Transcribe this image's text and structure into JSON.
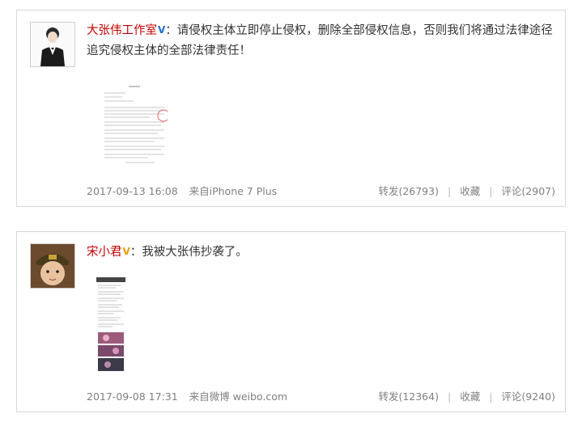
{
  "posts": [
    {
      "author": "大张伟工作室",
      "badge": "V",
      "badge_color": "#1e6cc8",
      "text": "请侵权主体立即停止侵权，删除全部侵权信息，否则我们将通过法律途径追究侵权主体的全部法律责任！",
      "colon": "：",
      "time": "2017-09-13 16:08",
      "source": "来自iPhone 7 Plus",
      "repost": "转发(26793)",
      "favorite": "收藏",
      "comment": "评论(2907)",
      "sep": "|",
      "avatar_icon": "person-in-suit-avatar",
      "attachment": "legal-notice-document-image"
    },
    {
      "author": "宋小君",
      "badge": "V",
      "badge_color": "#e89a10",
      "text": "我被大张伟抄袭了。",
      "colon": "：",
      "time": "2017-09-08 17:31",
      "source": "来自微博 weibo.com",
      "repost": "转发(12364)",
      "favorite": "收藏",
      "comment": "评论(9240)",
      "sep": "|",
      "avatar_icon": "child-with-cap-avatar",
      "attachment": "long-screenshot-image"
    }
  ]
}
